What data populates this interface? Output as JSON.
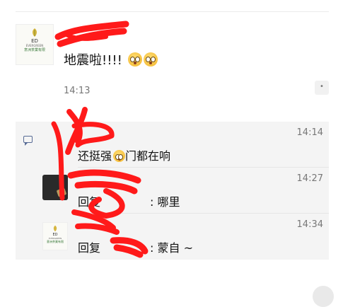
{
  "post": {
    "avatar": {
      "logo_ed": "ED",
      "logo_brand": "EVERGREEN",
      "logo_cn": "意洲茶業有限"
    },
    "text": "地震啦!!!!",
    "emoji_count": 2,
    "time": "14:13",
    "more_glyph": "•"
  },
  "comments": [
    {
      "text": "还挺强",
      "text_after_emoji": "门都在响",
      "has_emoji": true,
      "time": "14:14",
      "avatar": "none"
    },
    {
      "text": "回复",
      "hidden": "[redacted]",
      "text_after": ": 哪里",
      "time": "14:27",
      "avatar": "dark"
    },
    {
      "text": "回复",
      "hidden": "[redacted]",
      "text_after": ": 蒙自 ~",
      "time": "14:34",
      "avatar": "logo",
      "logo_ed": "ED",
      "logo_brand": "EVERGREEN",
      "logo_cn": "意洲茶業有限"
    }
  ],
  "colors": {
    "comment_bg": "#f4f4f4",
    "link_blue": "#576b95",
    "redaction": "#ff1a1a"
  }
}
